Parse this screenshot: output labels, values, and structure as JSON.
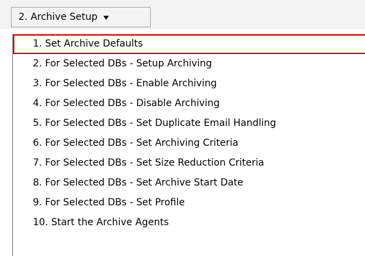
{
  "menu_button": {
    "label": "2. Archive Setup",
    "icon": "chevron-down-icon"
  },
  "dropdown": {
    "items": [
      {
        "label": "1. Set Archive Defaults",
        "selected": true
      },
      {
        "label": "2. For Selected DBs - Setup Archiving"
      },
      {
        "label": "3. For Selected DBs - Enable Archiving"
      },
      {
        "label": "4. For Selected DBs - Disable Archiving"
      },
      {
        "label": "5. For Selected DBs - Set Duplicate Email Handling"
      },
      {
        "label": "6. For Selected DBs - Set Archiving Criteria"
      },
      {
        "label": "7. For Selected DBs - Set Size Reduction Criteria"
      },
      {
        "label": "8. For Selected DBs - Set Archive Start Date"
      },
      {
        "label": "9. For Selected DBs - Set Profile"
      },
      {
        "label": "10. Start the Archive Agents"
      }
    ]
  },
  "colors": {
    "selection_outline": "#e00000",
    "menu_border": "#a9a9a9",
    "background": "#ffffff"
  }
}
